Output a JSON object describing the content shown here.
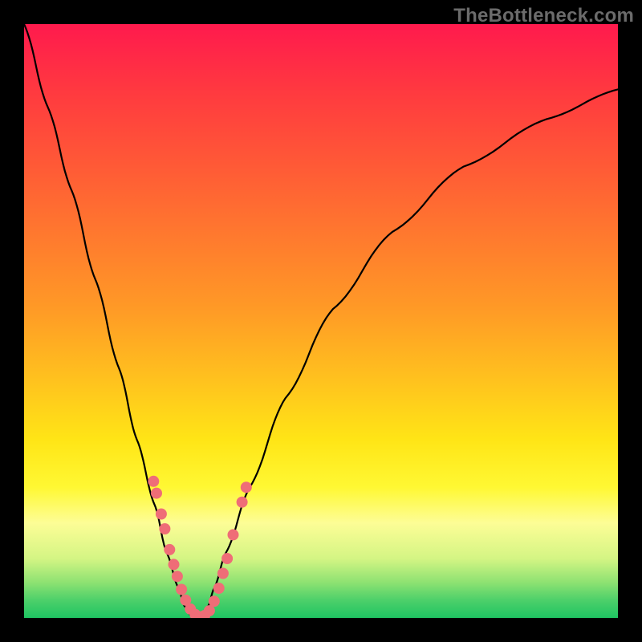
{
  "watermark": "TheBottleneck.com",
  "colors": {
    "frame": "#000000",
    "curve": "#000000",
    "dots": "#ef6d77",
    "grad_top": "#ff1a4d",
    "grad_bottom": "#1fc462"
  },
  "chart_data": {
    "type": "line",
    "title": "",
    "xlabel": "",
    "ylabel": "",
    "xlim": [
      0,
      100
    ],
    "ylim": [
      0,
      100
    ],
    "grid": false,
    "legend": false,
    "series": [
      {
        "name": "bottleneck-curve",
        "x": [
          0,
          4,
          8,
          12,
          16,
          19,
          22,
          24,
          26,
          27,
          28,
          29,
          30,
          31,
          32,
          34,
          38,
          44,
          52,
          62,
          74,
          88,
          100
        ],
        "y": [
          100,
          86,
          72,
          57,
          42,
          30,
          19,
          11,
          5,
          2,
          0.5,
          0,
          0.5,
          2,
          5,
          11,
          22,
          37,
          52,
          65,
          76,
          84,
          89
        ]
      }
    ],
    "dots": [
      {
        "x": 21.8,
        "y": 23.0
      },
      {
        "x": 22.3,
        "y": 21.0
      },
      {
        "x": 23.1,
        "y": 17.5
      },
      {
        "x": 23.7,
        "y": 15.0
      },
      {
        "x": 24.5,
        "y": 11.5
      },
      {
        "x": 25.2,
        "y": 9.0
      },
      {
        "x": 25.8,
        "y": 7.0
      },
      {
        "x": 26.5,
        "y": 4.8
      },
      {
        "x": 27.2,
        "y": 3.0
      },
      {
        "x": 28.0,
        "y": 1.5
      },
      {
        "x": 28.8,
        "y": 0.6
      },
      {
        "x": 29.6,
        "y": 0.2
      },
      {
        "x": 30.4,
        "y": 0.4
      },
      {
        "x": 31.2,
        "y": 1.2
      },
      {
        "x": 32.0,
        "y": 2.8
      },
      {
        "x": 32.8,
        "y": 5.0
      },
      {
        "x": 33.5,
        "y": 7.5
      },
      {
        "x": 34.2,
        "y": 10.0
      },
      {
        "x": 35.2,
        "y": 14.0
      },
      {
        "x": 36.7,
        "y": 19.5
      },
      {
        "x": 37.4,
        "y": 22.0
      }
    ]
  }
}
